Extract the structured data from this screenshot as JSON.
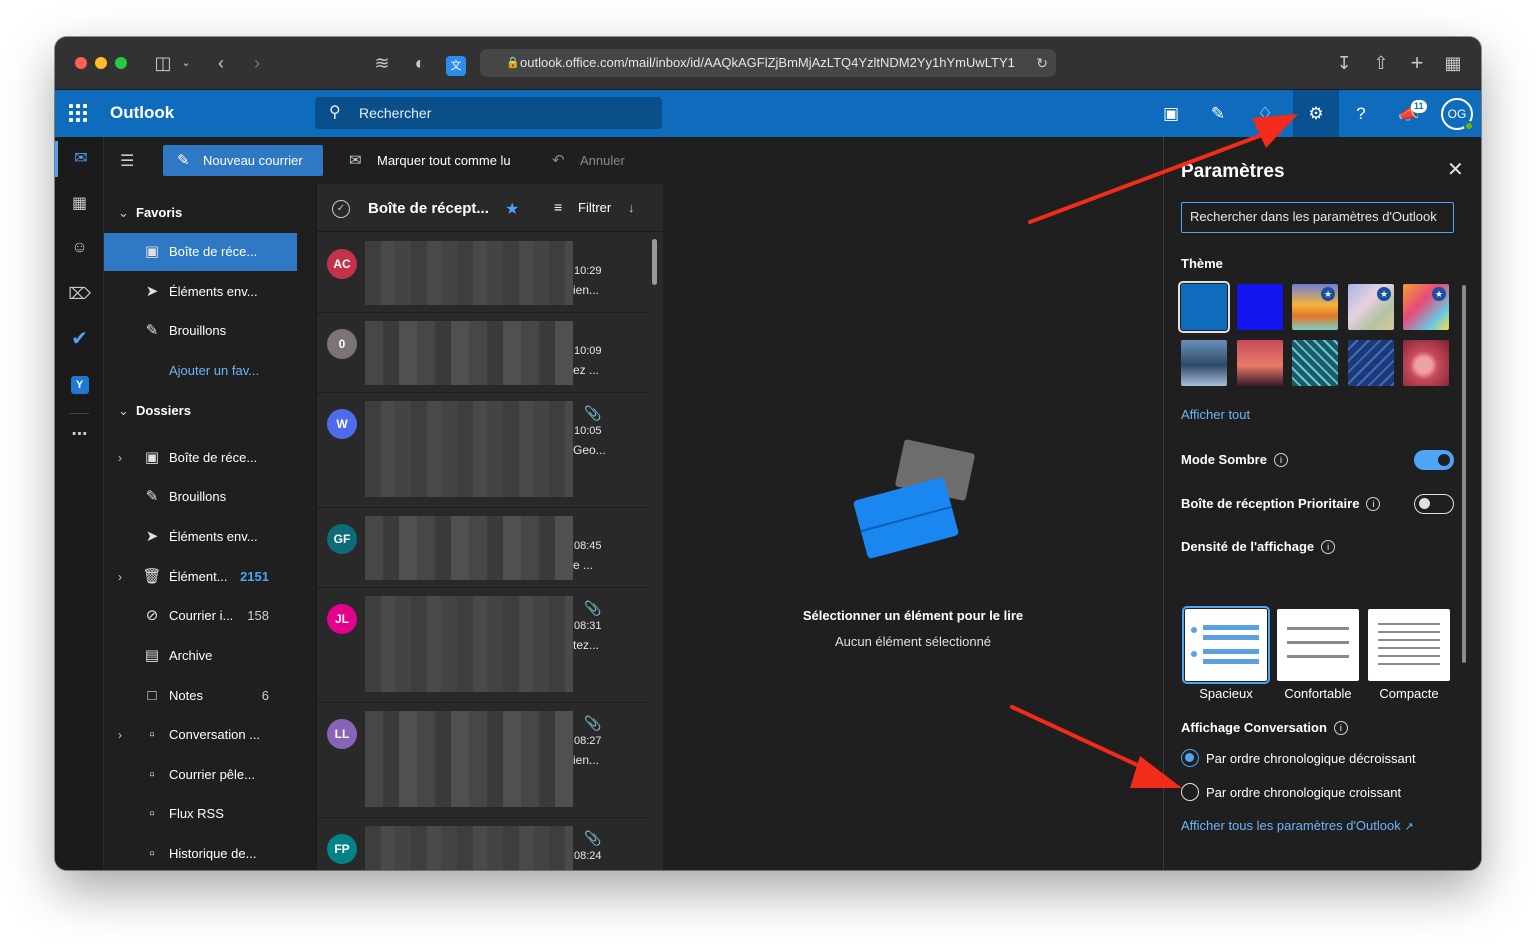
{
  "browser": {
    "url": "outlook.office.com/mail/inbox/id/AAQkAGFlZjBmMjAzLTQ4YzltNDM2Yy1hYmUwLTY1"
  },
  "topbar": {
    "brand": "Outlook",
    "search_placeholder": "Rechercher",
    "notifications_badge": "11",
    "avatar_initials": "OG"
  },
  "command_bar": {
    "new_mail": "Nouveau courrier",
    "mark_all_read": "Marquer tout comme lu",
    "undo": "Annuler"
  },
  "folders": {
    "favorites_header": "Favoris",
    "favorites": [
      {
        "label": "Boîte de réce...",
        "active": true
      },
      {
        "label": "Éléments env..."
      },
      {
        "label": "Brouillons"
      },
      {
        "label": "Ajouter un fav..."
      }
    ],
    "folders_header": "Dossiers",
    "items": [
      {
        "label": "Boîte de réce...",
        "count": ""
      },
      {
        "label": "Brouillons",
        "count": ""
      },
      {
        "label": "Éléments env...",
        "count": ""
      },
      {
        "label": "Élément...",
        "count": "2151"
      },
      {
        "label": "Courrier i...",
        "count": "158"
      },
      {
        "label": "Archive",
        "count": ""
      },
      {
        "label": "Notes",
        "count": "6"
      },
      {
        "label": "Conversation ...",
        "count": ""
      },
      {
        "label": "Courrier pêle...",
        "count": ""
      },
      {
        "label": "Flux RSS",
        "count": ""
      },
      {
        "label": "Historique de...",
        "count": ""
      }
    ]
  },
  "message_list": {
    "title": "Boîte de récept...",
    "filter": "Filtrer",
    "messages": [
      {
        "initials": "AC",
        "color": "#c4314b",
        "time": "10:29",
        "preview": "ien...",
        "attachment": false
      },
      {
        "initials": "0",
        "color": "#7a7574",
        "time": "10:09",
        "preview": "ez ...",
        "attachment": false
      },
      {
        "initials": "W",
        "color": "#4f6bed",
        "time": "10:05",
        "preview": "Geo...",
        "attachment": true
      },
      {
        "initials": "GF",
        "color": "#0e6b7a",
        "time": "08:45",
        "preview": "e ...",
        "attachment": false
      },
      {
        "initials": "JL",
        "color": "#e3008c",
        "time": "08:31",
        "preview": "tez...",
        "attachment": true
      },
      {
        "initials": "LL",
        "color": "#8764b8",
        "time": "08:27",
        "preview": "ien...",
        "attachment": true
      },
      {
        "initials": "FP",
        "color": "#038387",
        "time": "08:24",
        "preview": "",
        "attachment": true
      }
    ]
  },
  "reading_pane": {
    "title": "Sélectionner un élément pour le lire",
    "subtitle": "Aucun élément sélectionné"
  },
  "settings": {
    "title": "Paramètres",
    "search_placeholder": "Rechercher dans les paramètres d'Outlook",
    "theme_label": "Thème",
    "show_all": "Afficher tout",
    "dark_mode": "Mode Sombre",
    "focused_inbox": "Boîte de réception Prioritaire",
    "density_label": "Densité de l'affichage",
    "density_options": [
      "Spacieux",
      "Confortable",
      "Compacte"
    ],
    "conversation_label": "Affichage Conversation",
    "conversation_options": [
      "Par ordre chronologique décroissant",
      "Par ordre chronologique croissant"
    ],
    "all_settings_link": "Afficher tous les paramètres d'Outlook",
    "dark_mode_on": true,
    "focused_inbox_on": false
  }
}
